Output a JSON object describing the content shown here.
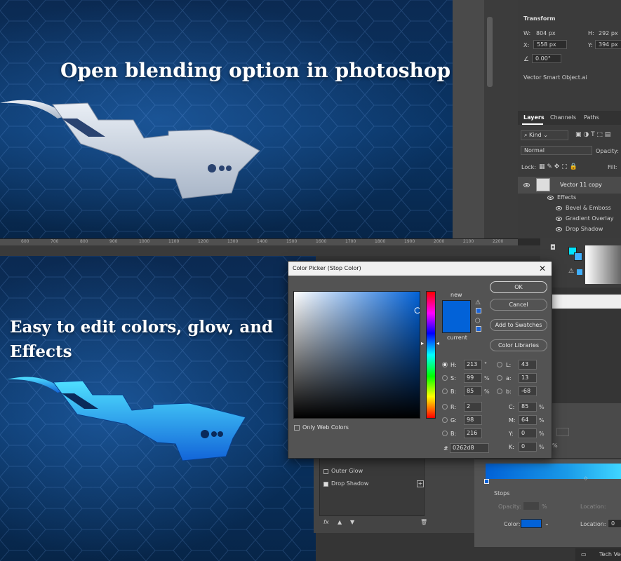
{
  "headlines": {
    "top": "Open blending option in photoshop",
    "bottom_line1": "Easy to edit colors, glow, and",
    "bottom_line2": "Effects"
  },
  "transform": {
    "title": "Transform",
    "w_label": "W:",
    "w_value": "804 px",
    "h_label": "H:",
    "h_value": "292 px",
    "x_label": "X:",
    "x_value": "558 px",
    "y_label": "Y:",
    "y_value": "394 px",
    "angle_value": "0.00°",
    "object_name": "Vector Smart Object.ai"
  },
  "layers_panel": {
    "tabs": [
      "Layers",
      "Channels",
      "Paths"
    ],
    "kind_label": "Kind",
    "blend_mode": "Normal",
    "opacity_label": "Opacity:",
    "lock_label": "Lock:",
    "fill_label": "Fill:",
    "layer_name": "Vector 11 copy",
    "effects_label": "Effects",
    "effects": [
      "Bevel & Emboss",
      "Gradient Overlay",
      "Drop Shadow"
    ]
  },
  "ruler_ticks": [
    "600",
    "700",
    "800",
    "900",
    "1000",
    "1100",
    "1200",
    "1300",
    "1400",
    "1500",
    "1600",
    "1700",
    "1800",
    "1900",
    "2000",
    "2100",
    "2200"
  ],
  "layer_style": {
    "outer_glow": "Outer Glow",
    "drop_shadow": "Drop Shadow",
    "fx_label": "fx"
  },
  "gradient_editor": {
    "stops_label": "Stops",
    "opacity_label": "Opacity:",
    "location_label": "Location:",
    "color_label": "Color:",
    "location_value": "0",
    "percent_symbol": "%",
    "color_hex": "#0262d8"
  },
  "bottom_right_item": "Tech Vect",
  "color_picker": {
    "title": "Color Picker (Stop Color)",
    "new_label": "new",
    "current_label": "current",
    "ok": "OK",
    "cancel": "Cancel",
    "add_to_swatches": "Add to Swatches",
    "color_libraries": "Color Libraries",
    "only_web_colors": "Only Web Colors",
    "hex_label": "#",
    "hex_value": "0262d8",
    "hsb": {
      "h_label": "H:",
      "h_value": "213",
      "h_unit": "°",
      "s_label": "S:",
      "s_value": "99",
      "s_unit": "%",
      "b_label": "B:",
      "b_value": "85",
      "b_unit": "%"
    },
    "rgb": {
      "r_label": "R:",
      "r_value": "2",
      "g_label": "G:",
      "g_value": "98",
      "b_label": "B:",
      "b_value": "216"
    },
    "lab": {
      "l_label": "L:",
      "l_value": "43",
      "a_label": "a:",
      "a_value": "13",
      "b_label": "b:",
      "b_value": "-68"
    },
    "cmyk": {
      "c_label": "C:",
      "c_value": "85",
      "m_label": "M:",
      "m_value": "64",
      "y_label": "Y:",
      "y_value": "0",
      "k_label": "K:",
      "k_value": "0",
      "unit": "%"
    },
    "selected_hue_color": "#0262d8"
  },
  "colors": {
    "fg_swatch": "#00e5ff",
    "logo_silver": "#c9d4e2",
    "logo_blue": "#1a7ee8",
    "logo_cyan": "#3fd6ff"
  }
}
